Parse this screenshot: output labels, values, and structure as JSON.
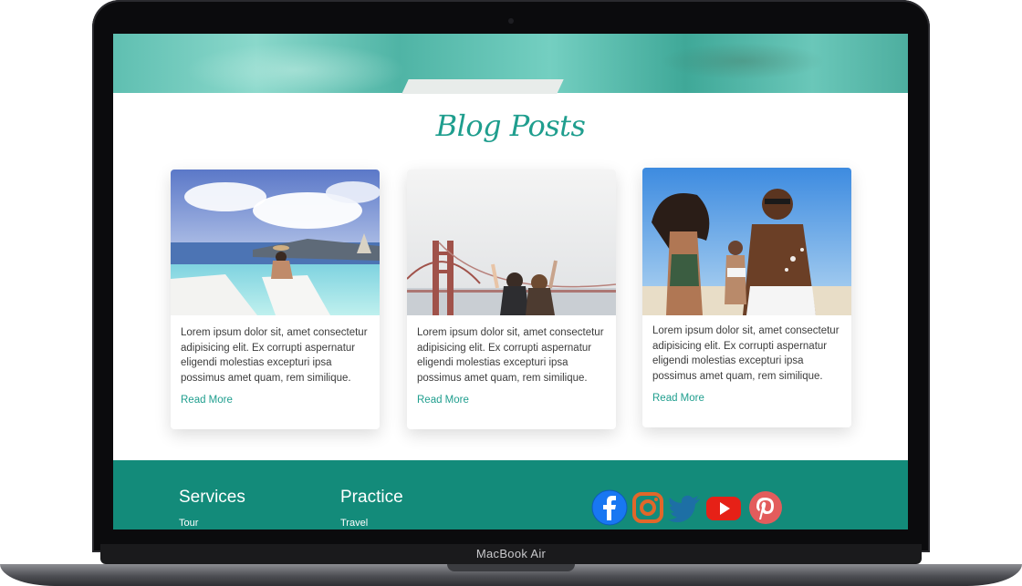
{
  "device": {
    "brand_label": "MacBook Air"
  },
  "page": {
    "section_title": "Blog Posts",
    "cards": [
      {
        "image": "infinity-pool-woman-photo",
        "text": "Lorem ipsum dolor sit, amet consectetur adipisicing elit. Ex corrupti aspernatur eligendi molestias excepturi ipsa possimus amet quam, rem similique.",
        "link": "Read More"
      },
      {
        "image": "golden-gate-bridge-friends-photo",
        "text": "Lorem ipsum dolor sit, amet consectetur adipisicing elit. Ex corrupti aspernatur eligendi molestias excepturi ipsa possimus amet quam, rem similique.",
        "link": "Read More"
      },
      {
        "image": "beach-friends-splash-photo",
        "text": "Lorem ipsum dolor sit, amet consectetur adipisicing elit. Ex corrupti aspernatur eligendi molestias excepturi ipsa possimus amet quam, rem similique.",
        "link": "Read More"
      }
    ],
    "footer": {
      "columns": [
        {
          "heading": "Services",
          "first_link": "Tour"
        },
        {
          "heading": "Practice",
          "first_link": "Travel"
        }
      ],
      "social": [
        {
          "name": "facebook-icon",
          "color": "#1877f2"
        },
        {
          "name": "instagram-icon",
          "color": "#e1672a"
        },
        {
          "name": "twitter-icon",
          "color": "#1d6fa5"
        },
        {
          "name": "youtube-icon",
          "color": "#e62117"
        },
        {
          "name": "pinterest-icon",
          "color": "#e60023"
        }
      ]
    },
    "colors": {
      "accent": "#1f9e8e",
      "footer_bg": "#138b7a"
    }
  }
}
